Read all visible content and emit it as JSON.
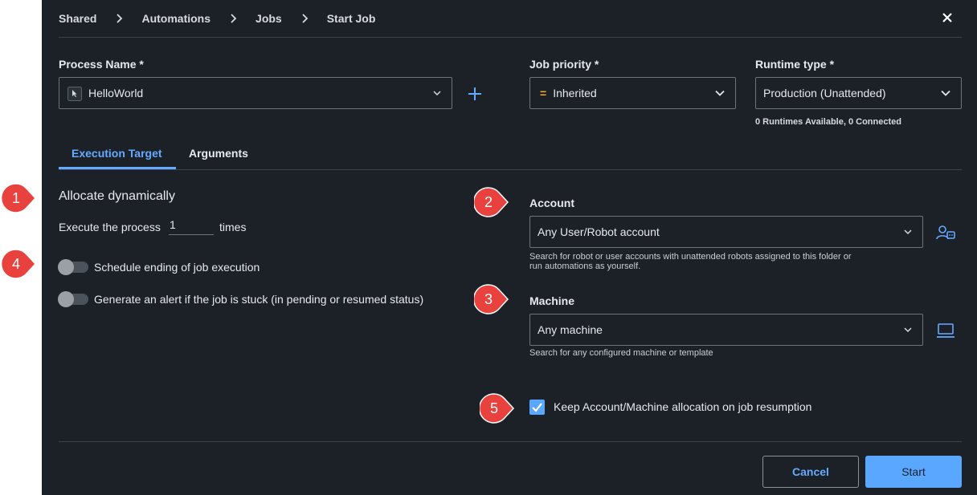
{
  "breadcrumb": [
    "Shared",
    "Automations",
    "Jobs",
    "Start Job"
  ],
  "process": {
    "label": "Process Name *",
    "value": "HelloWorld"
  },
  "priority": {
    "label": "Job priority *",
    "value": "Inherited",
    "symbol": "="
  },
  "runtime": {
    "label": "Runtime type *",
    "value": "Production (Unattended)",
    "note": "0 Runtimes Available, 0 Connected"
  },
  "tabs": [
    "Execution Target",
    "Arguments"
  ],
  "allocate": {
    "title": "Allocate dynamically",
    "execute_prefix": "Execute the process",
    "execute_count": "1",
    "execute_suffix": "times",
    "toggle_schedule": "Schedule ending of job execution",
    "toggle_alert": "Generate an alert if the job is stuck (in pending or resumed status)"
  },
  "account": {
    "label": "Account",
    "value": "Any User/Robot account",
    "help_line1": "Search for robot or user accounts with unattended robots assigned to this folder or",
    "help_line2": "run automations as yourself."
  },
  "machine": {
    "label": "Machine",
    "value": "Any machine",
    "help": "Search for any configured machine or template"
  },
  "keep_allocation": {
    "label": "Keep Account/Machine allocation on job resumption",
    "checked": true
  },
  "buttons": {
    "cancel": "Cancel",
    "start": "Start"
  },
  "callouts": [
    "1",
    "2",
    "3",
    "4",
    "5"
  ],
  "colors": {
    "panel": "#1c2128",
    "accent": "#66aaff",
    "primary_button": "#5aa7ff",
    "callout": "#e8413e",
    "priority_symbol": "#f5a623"
  }
}
